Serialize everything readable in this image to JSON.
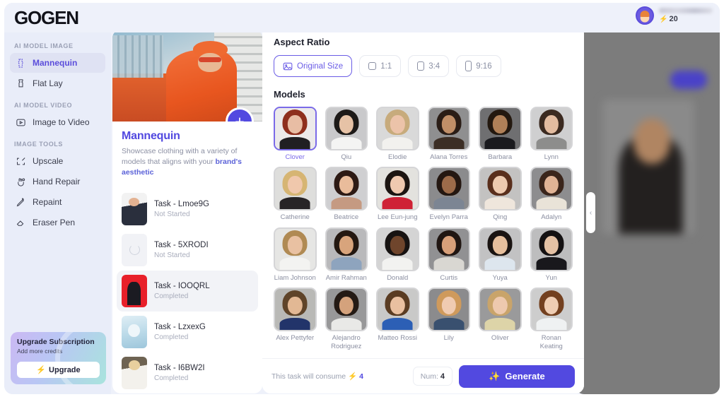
{
  "app": {
    "logo": "GOGEN"
  },
  "header": {
    "user_name": "",
    "credits": "20",
    "bolt_icon": "bolt-icon",
    "avatar_icon": "avatar"
  },
  "sidebar": {
    "sections": [
      {
        "label": "AI MODEL IMAGE",
        "items": [
          {
            "label": "Mannequin",
            "icon": "mannequin-icon",
            "active": true
          },
          {
            "label": "Flat Lay",
            "icon": "flat-lay-icon",
            "active": false
          }
        ]
      },
      {
        "label": "AI MODEL VIDEO",
        "items": [
          {
            "label": "Image to Video",
            "icon": "image-to-video-icon",
            "active": false
          }
        ]
      },
      {
        "label": "IMAGE TOOLS",
        "items": [
          {
            "label": "Upscale",
            "icon": "upscale-icon",
            "active": false
          },
          {
            "label": "Hand Repair",
            "icon": "hand-repair-icon",
            "active": false
          },
          {
            "label": "Repaint",
            "icon": "repaint-icon",
            "active": false
          },
          {
            "label": "Eraser Pen",
            "icon": "eraser-pen-icon",
            "active": false
          }
        ]
      }
    ],
    "upgrade": {
      "title": "Upgrade Subscription",
      "subtitle": "Add more credits",
      "button_label": "Upgrade",
      "button_icon": "bolt-icon"
    }
  },
  "task_card": {
    "title": "Mannequin",
    "description_plain": "Showcase clothing with a variety of models that aligns with your ",
    "description_highlight": "brand's aesthetic",
    "add_button_label": "+",
    "tasks": [
      {
        "name": "Task - Lmoe9G",
        "status": "Not Started",
        "selected": false,
        "thumb": "t1"
      },
      {
        "name": "Task - 5XRODI",
        "status": "Not Started",
        "selected": false,
        "thumb": "t2"
      },
      {
        "name": "Task - IOOQRL",
        "status": "Completed",
        "selected": true,
        "thumb": "t3"
      },
      {
        "name": "Task - LzxexG",
        "status": "Completed",
        "selected": false,
        "thumb": "t4"
      },
      {
        "name": "Task - I6BW2I",
        "status": "Completed",
        "selected": false,
        "thumb": "t5"
      }
    ]
  },
  "main": {
    "aspect_ratio": {
      "label": "Aspect Ratio",
      "options": [
        {
          "label": "Original Size",
          "icon": "image-icon",
          "shape": "orig",
          "active": true
        },
        {
          "label": "1:1",
          "icon": "square-icon",
          "shape": "sq",
          "active": false
        },
        {
          "label": "3:4",
          "icon": "portrait-icon",
          "shape": "r34",
          "active": false
        },
        {
          "label": "9:16",
          "icon": "tall-icon",
          "shape": "r916",
          "active": false
        }
      ]
    },
    "models": {
      "label": "Models",
      "items": [
        {
          "name": "Clover",
          "selected": true,
          "bg": "#eceaea",
          "hair": "#8e2f1d",
          "skin": "#e8bda4",
          "body": "#201f22"
        },
        {
          "name": "Qiu",
          "selected": false,
          "bg": "#c9c9cb",
          "hair": "#1d1a18",
          "skin": "#e6c2a6",
          "body": "#f4f4f3"
        },
        {
          "name": "Elodie",
          "selected": false,
          "bg": "#d9d9d9",
          "hair": "#c7ab7c",
          "skin": "#ecc3a9",
          "body": "#f2f1ee"
        },
        {
          "name": "Alana Torres",
          "selected": false,
          "bg": "#8f8f90",
          "hair": "#2a1d16",
          "skin": "#c08f68",
          "body": "#3c2e25"
        },
        {
          "name": "Barbara",
          "selected": false,
          "bg": "#6f6f71",
          "hair": "#23180f",
          "skin": "#b08058",
          "body": "#1a1a1e"
        },
        {
          "name": "Lynn",
          "selected": false,
          "bg": "#cfcfd0",
          "hair": "#3b2a20",
          "skin": "#e3bca0",
          "body": "#8d8d8c"
        },
        {
          "name": "Catherine",
          "selected": false,
          "bg": "#dededc",
          "hair": "#d6b573",
          "skin": "#f0c8ac",
          "body": "#272426"
        },
        {
          "name": "Beatrice",
          "selected": false,
          "bg": "#cfcfd1",
          "hair": "#2d1a14",
          "skin": "#e9bc9b",
          "body": "#c59a82"
        },
        {
          "name": "Lee Eun-jung",
          "selected": false,
          "bg": "#e3e2de",
          "hair": "#1c1512",
          "skin": "#efc9b0",
          "body": "#cf2236"
        },
        {
          "name": "Evelyn Parra",
          "selected": false,
          "bg": "#8b8b8d",
          "hair": "#241711",
          "skin": "#9c6b4a",
          "body": "#7c8593"
        },
        {
          "name": "Qing",
          "selected": false,
          "bg": "#c3c2c1",
          "hair": "#5a2f1c",
          "skin": "#eecaaf",
          "body": "#efe6dc"
        },
        {
          "name": "Adalyn",
          "selected": false,
          "bg": "#8d8d8f",
          "hair": "#3a251b",
          "skin": "#e0b395",
          "body": "#e9e3d8"
        },
        {
          "name": "Liam Johnson",
          "selected": false,
          "bg": "#e6e6e4",
          "hair": "#b08a53",
          "skin": "#e9c1a2",
          "body": "#f3f3f1"
        },
        {
          "name": "Amir Rahman",
          "selected": false,
          "bg": "#b9b9bb",
          "hair": "#241811",
          "skin": "#d8a47c",
          "body": "#8ea4be"
        },
        {
          "name": "Donald",
          "selected": false,
          "bg": "#d4d4d4",
          "hair": "#171312",
          "skin": "#6f452c",
          "body": "#f2f2f0"
        },
        {
          "name": "Curtis",
          "selected": false,
          "bg": "#919193",
          "hair": "#201612",
          "skin": "#d8a07a",
          "body": "#d9d7d2"
        },
        {
          "name": "Yuya",
          "selected": false,
          "bg": "#c2c2c3",
          "hair": "#1a1412",
          "skin": "#e6bf9d",
          "body": "#dde6ee"
        },
        {
          "name": "Yun",
          "selected": false,
          "bg": "#bdbdbe",
          "hair": "#141112",
          "skin": "#e4c1a4",
          "body": "#19181c"
        },
        {
          "name": "Alex Pettyfer",
          "selected": false,
          "bg": "#b9b9b6",
          "hair": "#5f4429",
          "skin": "#e2b894",
          "body": "#22346a"
        },
        {
          "name": "Alejandro Rodriguez",
          "selected": false,
          "bg": "#989899",
          "hair": "#241a14",
          "skin": "#d4a27c",
          "body": "#e9e9e7"
        },
        {
          "name": "Matteo Rossi",
          "selected": false,
          "bg": "#c9c9c8",
          "hair": "#5a3c22",
          "skin": "#e9c0a0",
          "body": "#2c5fb5"
        },
        {
          "name": "Lily",
          "selected": false,
          "bg": "#8b8b8d",
          "hair": "#cf9a5c",
          "skin": "#f0cbb2",
          "body": "#39506f"
        },
        {
          "name": "Oliver",
          "selected": false,
          "bg": "#9a9a9b",
          "hair": "#c9a46a",
          "skin": "#eec9ae",
          "body": "#ddd4a8"
        },
        {
          "name": "Ronan Keating",
          "selected": false,
          "bg": "#cdcdcd",
          "hair": "#73401f",
          "skin": "#efcdb3",
          "body": "#eff1f2"
        }
      ]
    },
    "footer": {
      "consume_text": "This task will consume",
      "consume_amount": "4",
      "consume_icon": "bolt-icon",
      "num_label": "Num:",
      "num_value": "4",
      "generate_label": "Generate",
      "generate_icon": "sparkles-icon"
    }
  },
  "right_pane": {
    "collapse_icon": "chevron-left-icon"
  }
}
